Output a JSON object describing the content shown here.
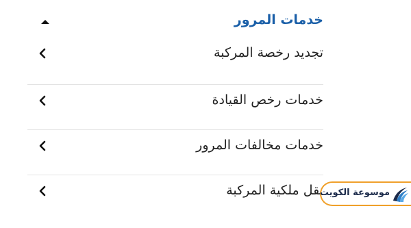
{
  "section": {
    "title": "خدمات المرور",
    "toggle_icon": "caret-up-icon",
    "accent_color": "#1a5fa8"
  },
  "items": [
    {
      "label": "تجديد رخصة المركبة",
      "icon": "chevron-left-icon"
    },
    {
      "label": "خدمات رخص القيادة",
      "icon": "chevron-left-icon"
    },
    {
      "label": "خدمات مخالفات المرور",
      "icon": "chevron-left-icon"
    },
    {
      "label": "نقل ملكية المركبة",
      "icon": "chevron-left-icon"
    }
  ],
  "watermark": {
    "text": "موسوعة الكويت",
    "icon": "site-logo-icon",
    "border_color": "#f0a02a"
  }
}
